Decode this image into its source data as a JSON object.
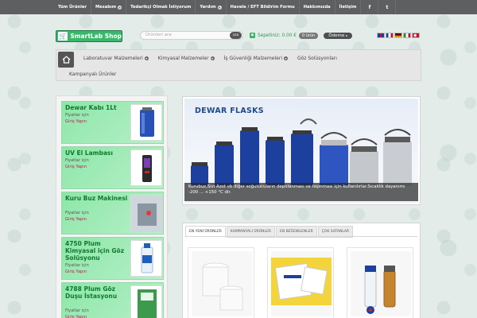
{
  "topnav": {
    "items": [
      {
        "label": "Tüm Ürünler",
        "dropdown": false
      },
      {
        "label": "Mesabım",
        "dropdown": true
      },
      {
        "label": "Tedarikçi Olmak İstiyorum",
        "dropdown": false
      },
      {
        "label": "Yardım",
        "dropdown": true
      },
      {
        "label": "Havale / EFT Bildirim Formu",
        "dropdown": false
      },
      {
        "label": "Hakkımızda",
        "dropdown": false
      },
      {
        "label": "İletişim",
        "dropdown": false
      }
    ],
    "social": [
      {
        "icon": "facebook-icon",
        "glyph": "f"
      },
      {
        "icon": "twitter-icon",
        "glyph": "t"
      }
    ]
  },
  "header": {
    "logo_text": "SmartLab Shop",
    "search_placeholder": "Ürünleri ara",
    "search_button": "ara",
    "cart_label": "Sepetiniz: 0.00 €",
    "cart_count": "0 ürün",
    "checkout_label": "Ödeme",
    "flags": [
      {
        "name": "flag-uk-icon",
        "colors": [
          "#1f3f8f",
          "#ffffff",
          "#c8102e"
        ]
      },
      {
        "name": "flag-fr-icon",
        "colors": [
          "#1f3f8f",
          "#ffffff",
          "#c8102e"
        ]
      },
      {
        "name": "flag-de-icon",
        "colors": [
          "#111111",
          "#c8102e",
          "#f2c200"
        ]
      },
      {
        "name": "flag-it-icon",
        "colors": [
          "#1f8a3b",
          "#ffffff",
          "#c8102e"
        ]
      },
      {
        "name": "flag-tr-icon",
        "colors": [
          "#c8102e",
          "#c8102e",
          "#c8102e"
        ]
      }
    ]
  },
  "mainnav": {
    "row1": [
      {
        "label": "Laboratuvar Malzemeleri",
        "dropdown": true
      },
      {
        "label": "Kimyasal Malzemeler",
        "dropdown": true
      },
      {
        "label": "İş Güvenliği Malzemeleri",
        "dropdown": true
      },
      {
        "label": "Göz Solüsyonları",
        "dropdown": false
      }
    ],
    "row2": [
      {
        "label": "Kampanyalı Ürünler",
        "dropdown": false
      }
    ]
  },
  "sidebar": {
    "price_label": "Fiyatlar için",
    "login_label": "Giriş Yapın",
    "promos": [
      {
        "title": "Dewar Kabı 1Lt"
      },
      {
        "title": "UV El Lambası"
      },
      {
        "title": "Kuru Buz Makinesi"
      },
      {
        "title": "4750 Plum Kimyasal için Göz Solüsyonu"
      },
      {
        "title": "4788 Plum Göz Duşu İstasyonu"
      }
    ]
  },
  "slider": {
    "title": "DEWAR FLASKS",
    "caption": "Kurubuz,Sıvı Azot vb diğer soğutucuların depolanması ve taşınması için kullanılırlar.Sıcaklık dayanımı -200 ... +150 °C dir."
  },
  "tabs": {
    "items": [
      {
        "label": "EN YENİ ÜRÜNLER",
        "active": true
      },
      {
        "label": "KAMPANYALI ÜRÜNLER",
        "active": false
      },
      {
        "label": "EN BEĞENİLENLER",
        "active": false
      },
      {
        "label": "ÇOK SATANLAR",
        "active": false
      }
    ]
  },
  "products": [
    {
      "icon": "white-jar-image"
    },
    {
      "icon": "labels-image"
    },
    {
      "icon": "vials-image"
    }
  ],
  "colors": {
    "brand_green": "#39b86b",
    "promo_title": "#0e7a2f",
    "login_link": "#c2185b",
    "topbar_bg": "#5d5f60"
  }
}
